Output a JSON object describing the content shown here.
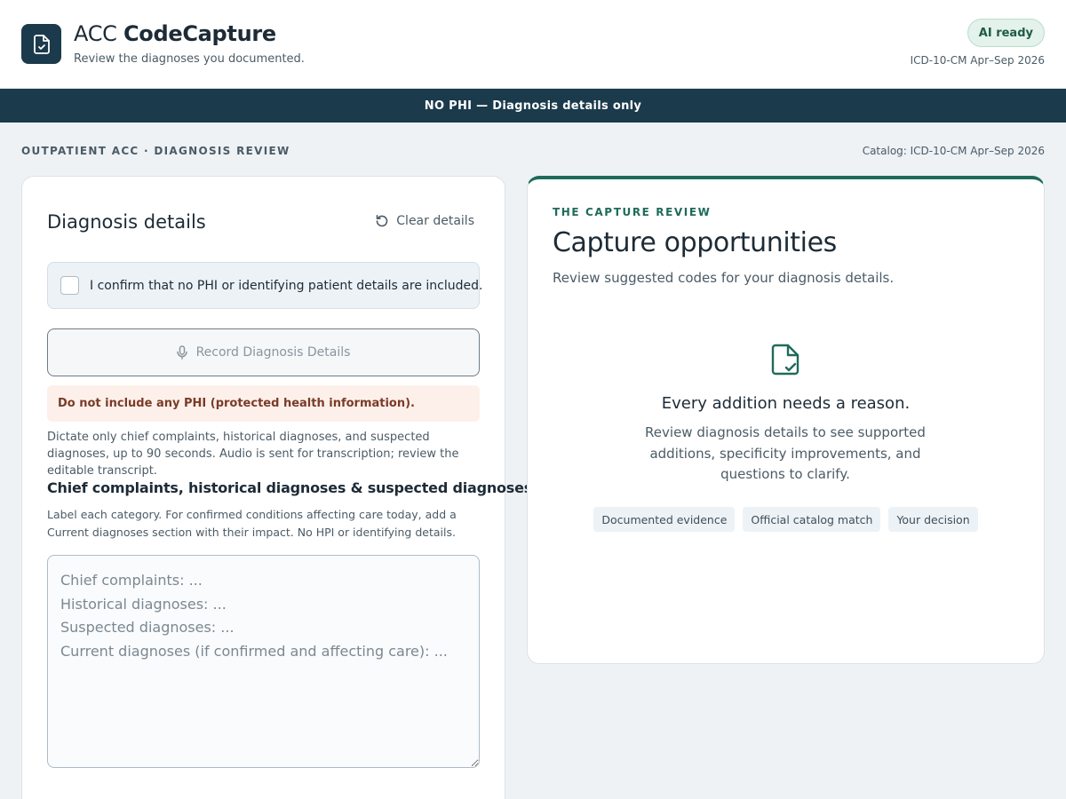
{
  "header": {
    "title_prefix": "ACC",
    "title_bold": "CodeCapture",
    "subtitle": "Review the diagnoses you documented.",
    "badge": "AI ready",
    "catalog": "ICD-10-CM Apr–Sep 2026",
    "logo_icon": "document-check-icon"
  },
  "banner": {
    "text": "NO PHI — Diagnosis details only"
  },
  "section": {
    "label": "OUTPATIENT ACC · DIAGNOSIS REVIEW",
    "catalog": "Catalog: ICD-10-CM Apr–Sep 2026"
  },
  "details": {
    "title": "Diagnosis details",
    "clear_label": "Clear details",
    "clear_icon": "refresh-icon",
    "confirm_label": "I confirm that no PHI or identifying patient details are included.",
    "record_label": "Record Diagnosis Details",
    "record_icon": "microphone-icon",
    "phi_warning": "Do not include any PHI (protected health information).",
    "dictate_help": "Dictate only chief complaints, historical diagnoses, and suspected diagnoses, up to 90 seconds. Audio is sent for transcription; review the editable transcript.",
    "field_heading": "Chief complaints, historical diagnoses & suspected diagnoses",
    "field_help": "Label each category. For confirmed conditions affecting care today, add a Current diagnoses section with their impact. No HPI or identifying details.",
    "placeholder": "Chief complaints: ...\nHistorical diagnoses: ...\nSuspected diagnoses: ...\nCurrent diagnoses (if confirmed and affecting care): ...",
    "value": ""
  },
  "review": {
    "eyebrow": "THE CAPTURE REVIEW",
    "title": "Capture opportunities",
    "description": "Review suggested codes for your diagnosis details.",
    "empty_icon": "document-check-icon",
    "empty_title": "Every addition needs a reason.",
    "empty_description": "Review diagnosis details to see supported additions, specificity improvements, and questions to clarify.",
    "chips": [
      "Documented evidence",
      "Official catalog match",
      "Your decision"
    ]
  },
  "colors": {
    "brand_dark": "#1b3a4c",
    "accent_green": "#1e6b5a",
    "warning_bg": "#fdf0ea"
  }
}
